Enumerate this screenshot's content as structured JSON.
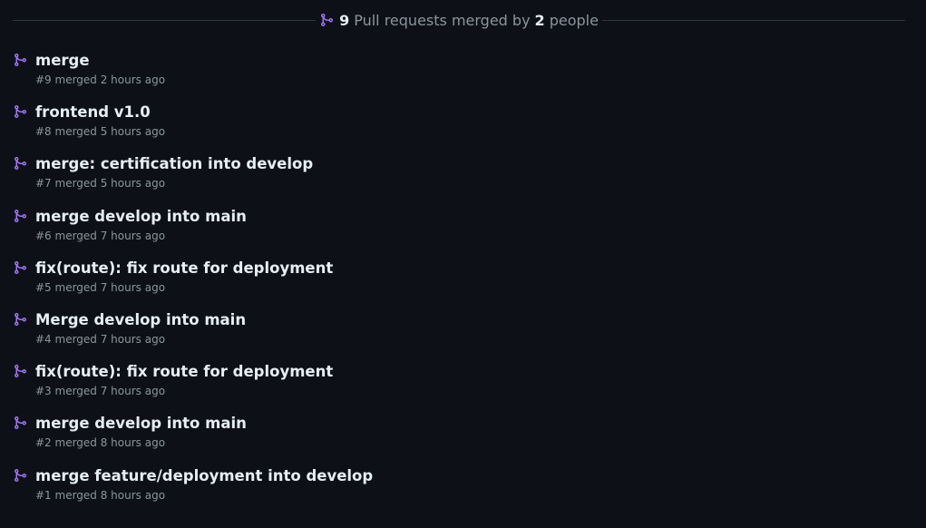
{
  "header": {
    "count": "9",
    "middle_text": "Pull requests merged by",
    "people_count": "2",
    "people_text": "people",
    "icon": "git-merge-icon"
  },
  "colors": {
    "background": "#0d1117",
    "merged_purple": "#a371f7",
    "text_primary": "#e6edf3",
    "text_muted": "#8b949e"
  },
  "pull_requests": [
    {
      "title": "merge",
      "meta": "#9 merged 2 hours ago",
      "icon": "git-merge-icon"
    },
    {
      "title": "frontend v1.0",
      "meta": "#8 merged 5 hours ago",
      "icon": "git-merge-icon"
    },
    {
      "title": "merge: certification into develop",
      "meta": "#7 merged 5 hours ago",
      "icon": "git-merge-icon"
    },
    {
      "title": "merge develop into main",
      "meta": "#6 merged 7 hours ago",
      "icon": "git-merge-icon"
    },
    {
      "title": "fix(route): fix route for deployment",
      "meta": "#5 merged 7 hours ago",
      "icon": "git-merge-icon"
    },
    {
      "title": "Merge develop into main",
      "meta": "#4 merged 7 hours ago",
      "icon": "git-merge-icon"
    },
    {
      "title": "fix(route): fix route for deployment",
      "meta": "#3 merged 7 hours ago",
      "icon": "git-merge-icon"
    },
    {
      "title": "merge develop into main",
      "meta": "#2 merged 8 hours ago",
      "icon": "git-merge-icon"
    },
    {
      "title": "merge feature/deployment into develop",
      "meta": "#1 merged 8 hours ago",
      "icon": "git-merge-icon"
    }
  ]
}
